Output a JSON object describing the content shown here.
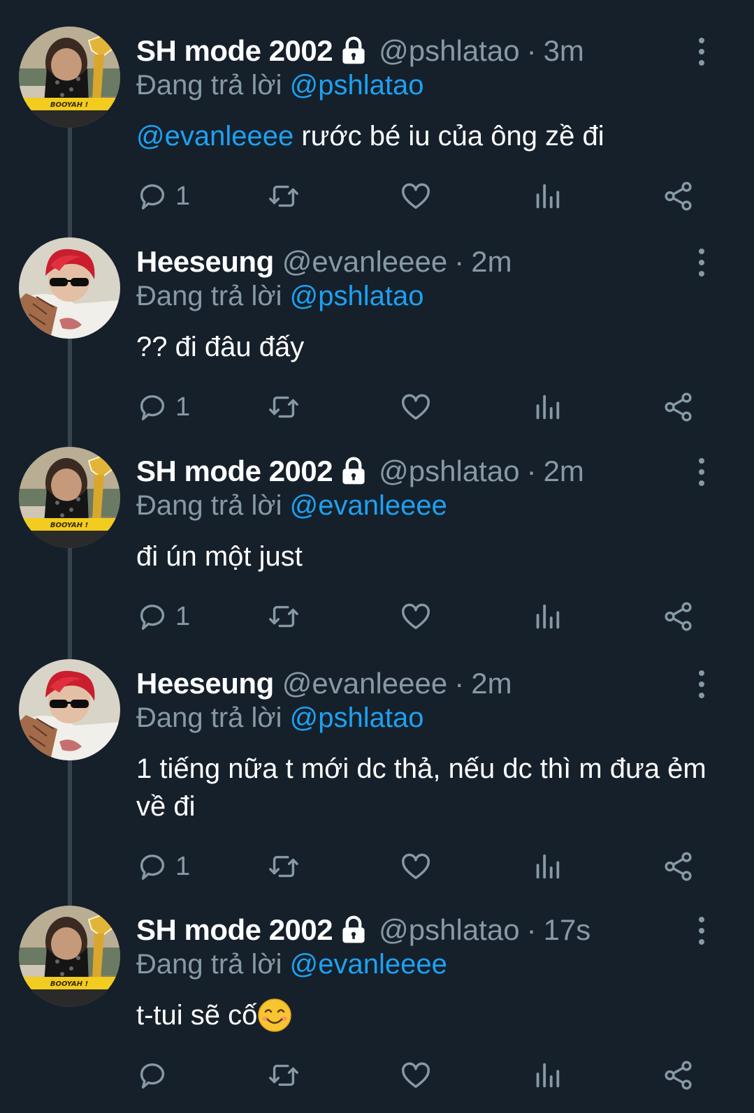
{
  "colors": {
    "background": "#15202b",
    "text_primary": "#ffffff",
    "text_secondary": "#8899a6",
    "link": "#1da1f2",
    "thread_line": "#38444d"
  },
  "tweets": [
    {
      "name": "SH mode 2002",
      "protected": true,
      "handle": "@pshlatao",
      "separator": "·",
      "time": "3m",
      "replying_label": "Đang trả lời",
      "replying_to": "@pshlatao",
      "body_mention": "@evanleeee",
      "body_text": " rước bé iu của ông zề đi",
      "reply_count": "1",
      "avatar_icon": "masked-avatar-icon"
    },
    {
      "name": "Heeseung",
      "protected": false,
      "handle": "@evanleeee",
      "separator": "·",
      "time": "2m",
      "replying_label": "Đang trả lời",
      "replying_to": "@pshlatao",
      "body_mention": "",
      "body_text": "?? đi đâu đấy",
      "reply_count": "1",
      "avatar_icon": "red-hair-avatar-icon"
    },
    {
      "name": "SH mode 2002",
      "protected": true,
      "handle": "@pshlatao",
      "separator": "·",
      "time": "2m",
      "replying_label": "Đang trả lời",
      "replying_to": "@evanleeee",
      "body_mention": "",
      "body_text": "đi ún một just",
      "reply_count": "1",
      "avatar_icon": "masked-avatar-icon"
    },
    {
      "name": "Heeseung",
      "protected": false,
      "handle": "@evanleeee",
      "separator": "·",
      "time": "2m",
      "replying_label": "Đang trả lời",
      "replying_to": "@pshlatao",
      "body_mention": "",
      "body_text": "1 tiếng nữa t mới dc thả, nếu dc thì m đưa ẻm về đi",
      "reply_count": "1",
      "avatar_icon": "red-hair-avatar-icon"
    },
    {
      "name": "SH mode 2002",
      "protected": true,
      "handle": "@pshlatao",
      "separator": "·",
      "time": "17s",
      "replying_label": "Đang trả lời",
      "replying_to": "@evanleeee",
      "body_mention": "",
      "body_text": "t-tui sẽ cố",
      "body_emoji": "smiling-face-emoji",
      "reply_count": "",
      "avatar_icon": "masked-avatar-icon"
    }
  ],
  "avatar_badge_text": "BOOYAH !",
  "icons": {
    "reply": "reply-icon",
    "retweet": "retweet-icon",
    "like": "heart-icon",
    "analytics": "analytics-icon",
    "share": "share-icon",
    "more": "more-vertical-icon",
    "lock": "lock-icon"
  }
}
